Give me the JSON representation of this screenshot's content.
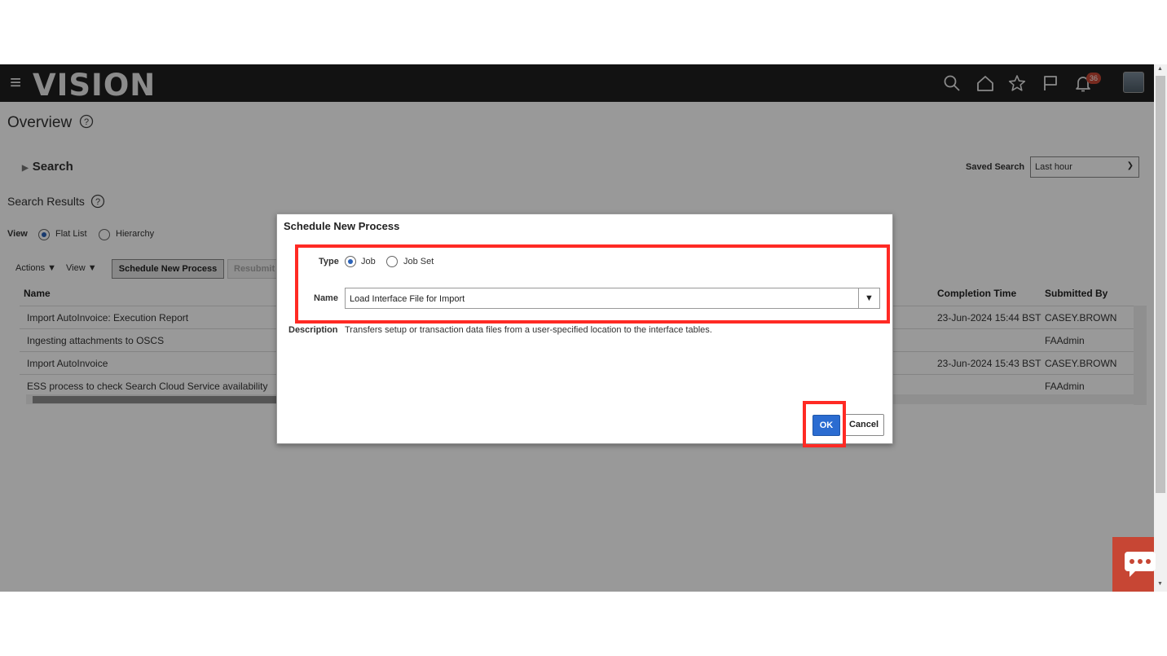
{
  "header": {
    "logo": "VISION",
    "notification_count": "36",
    "icons": [
      "menu-icon",
      "search-icon",
      "home-icon",
      "star-icon",
      "flag-icon",
      "bell-icon"
    ]
  },
  "page": {
    "title": "Overview",
    "search_label": "Search",
    "saved_search_label": "Saved Search",
    "saved_search_value": "Last hour",
    "results_label": "Search Results",
    "view_label": "View",
    "view_options": [
      "Flat List",
      "Hierarchy"
    ],
    "view_selected": "Flat List",
    "toolbar": {
      "actions": "Actions",
      "view": "View",
      "schedule": "Schedule New Process",
      "resubmit": "Resubmit"
    },
    "table": {
      "columns": [
        "Name",
        "Completion Time",
        "Submitted By"
      ],
      "rows": [
        {
          "name": "Import AutoInvoice: Execution Report",
          "completion": "23-Jun-2024 15:44 BST",
          "submitted": "CASEY.BROWN"
        },
        {
          "name": "Ingesting attachments to OSCS",
          "completion": "",
          "submitted": "FAAdmin"
        },
        {
          "name": "Import AutoInvoice",
          "completion": "23-Jun-2024 15:43 BST",
          "submitted": "CASEY.BROWN"
        },
        {
          "name": "ESS process to check Search Cloud Service availability",
          "completion": "",
          "submitted": "FAAdmin"
        }
      ]
    }
  },
  "dialog": {
    "title": "Schedule New Process",
    "type_label": "Type",
    "type_options": [
      "Job",
      "Job Set"
    ],
    "type_selected": "Job",
    "name_label": "Name",
    "name_value": "Load Interface File for Import",
    "description_label": "Description",
    "description_value": "Transfers setup or transaction data files from a user-specified location to the interface tables.",
    "ok": "OK",
    "cancel": "Cancel"
  },
  "colors": {
    "header_bg": "#1f1f1f",
    "primary_button": "#2b6cd1",
    "highlight": "#ff2a24",
    "badge": "#c74634"
  }
}
